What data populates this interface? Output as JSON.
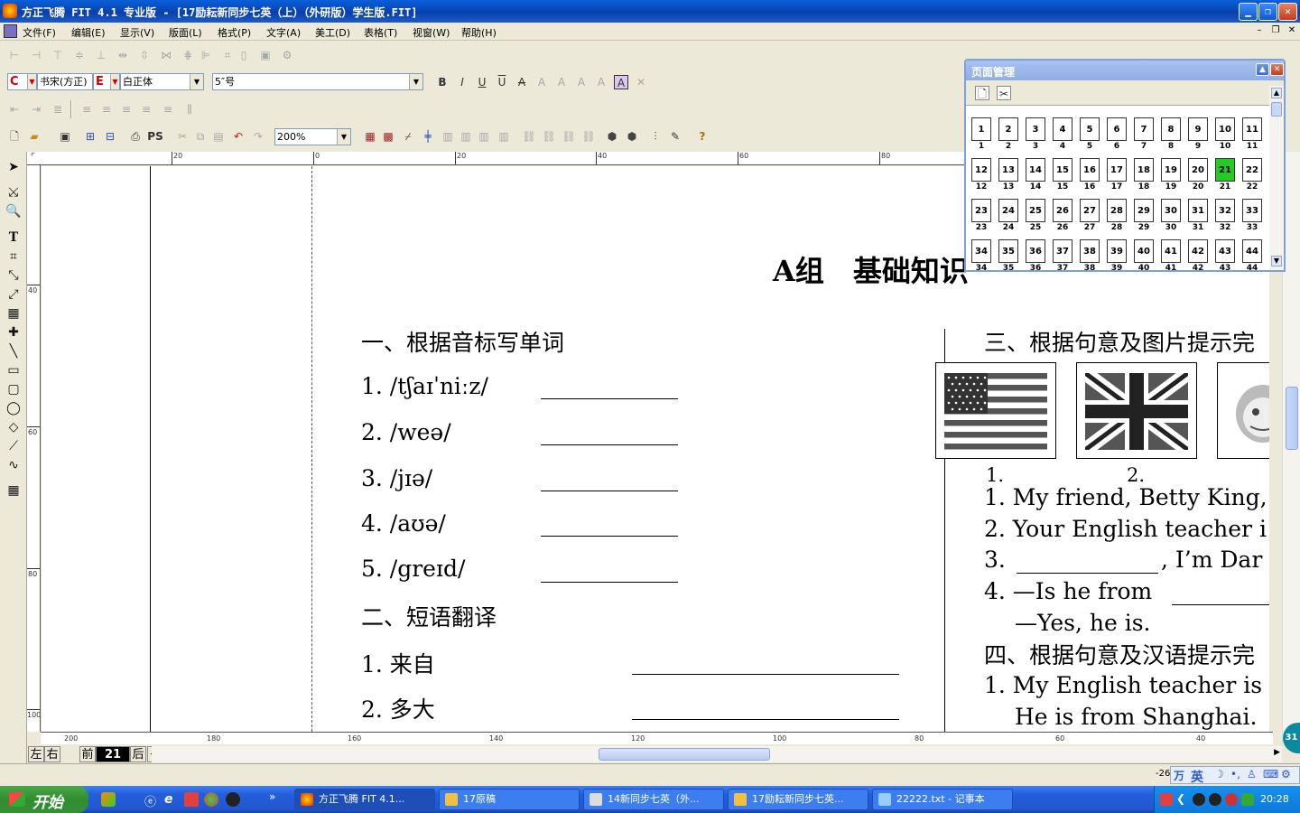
{
  "window": {
    "title": "方正飞腾 FIT 4.1 专业版 - [17励耘新同步七英（上）（外研版）学生版.FIT]"
  },
  "menu": [
    "文件(F)",
    "编辑(E)",
    "显示(V)",
    "版面(L)",
    "格式(P)",
    "文字(A)",
    "美工(D)",
    "表格(T)",
    "视窗(W)",
    "帮助(H)"
  ],
  "format_bar": {
    "cn_font": "书宋(方正)",
    "en_font": "白正体",
    "size": "5″号",
    "cn_font_label": "C",
    "en_font_label": "E"
  },
  "standard_bar": {
    "zoom": "200%",
    "ps_label": "PS"
  },
  "ruler": {
    "top_ticks": [
      "20",
      "0",
      "20",
      "40",
      "60",
      "80"
    ],
    "left_ticks": [
      "40",
      "60",
      "80",
      "100"
    ],
    "bottom_ticks": [
      "200",
      "180",
      "160",
      "140",
      "120",
      "100",
      "80",
      "60",
      "40"
    ]
  },
  "document": {
    "group_heading": "A组　基础知识",
    "section1": {
      "title": "一、根据音标写单词",
      "items": [
        "1.  /tʃaɪˈniːz/",
        "2.  /weə/",
        "3.  /jɪə/",
        "4.  /aʊə/",
        "5.  /greɪd/"
      ]
    },
    "section2": {
      "title": "二、短语翻译",
      "items": [
        "1.  来自",
        "2.  多大"
      ]
    },
    "section3": {
      "title": "三、根据句意及图片提示完",
      "pic_labels": [
        "1.",
        "2."
      ],
      "items": [
        "1.  My  friend,  Betty  King,",
        "2.  Your  English  teacher  i",
        "3.",
        ",  I’m  Dar",
        "4.  —Is  he  from",
        "—Yes,  he  is."
      ]
    },
    "section4": {
      "title": "四、根据句意及汉语提示完",
      "items": [
        "1.  My  English  teacher  is",
        "He  is  from  Shanghai."
      ]
    }
  },
  "page_nav": {
    "left": "左",
    "right": "右",
    "prev": "前",
    "current": "21",
    "next": "后"
  },
  "status": {
    "coord": "-26"
  },
  "page_manager": {
    "title": "页面管理",
    "pages": [
      "1",
      "2",
      "3",
      "4",
      "5",
      "6",
      "7",
      "8",
      "9",
      "10",
      "11",
      "12",
      "13",
      "14",
      "15",
      "16",
      "17",
      "18",
      "19",
      "20",
      "21",
      "22",
      "23",
      "24",
      "25",
      "26",
      "27",
      "28",
      "29",
      "30",
      "31",
      "32",
      "33",
      "34",
      "35",
      "36",
      "37",
      "38",
      "39",
      "40",
      "41",
      "42",
      "43",
      "44"
    ],
    "current_page": "21",
    "current_color": "#22cc22"
  },
  "taskbar": {
    "start": "开始",
    "tasks": [
      "方正飞腾 FIT 4.1...",
      "17原稿",
      "14新同步七英（外...",
      "17励耘新同步七英...",
      "22222.txt - 记事本"
    ],
    "clock": "20:28",
    "ime": "英",
    "side_badge": "31"
  },
  "colors": {
    "titlebar": "#0747b8",
    "taskbar": "#245edb",
    "start": "#2f8d2f",
    "current_page": "#22cc22"
  }
}
